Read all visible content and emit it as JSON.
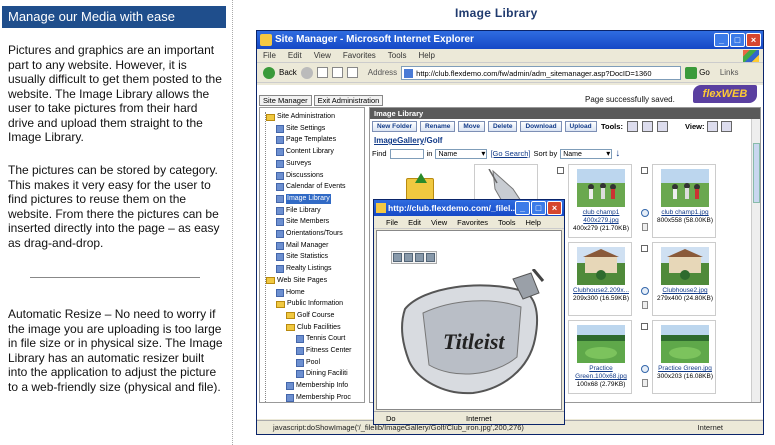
{
  "left": {
    "header": "Manage our Media with ease",
    "para1": "Pictures and graphics are an important part to any website. However, it is usually difficult to get them posted to the website. The Image Library allows the user to take pictures from their hard drive and upload them straight to the Image Library.",
    "para2": "The pictures can be stored by category.  This makes it very easy for the user to find pictures to reuse them on the website.  From there the pictures can be inserted directly into the page – as easy as drag-and-drop.",
    "para3": "Automatic Resize – No need to worry if the image you are uploading is too large in file size or in physical size.  The Image Library has an automatic resizer built into the application to adjust the picture to a web-friendly size (physical and file)."
  },
  "right_title": "Image Library",
  "ie": {
    "title": "Site Manager - Microsoft Internet Explorer",
    "menu": [
      "File",
      "Edit",
      "View",
      "Favorites",
      "Tools",
      "Help"
    ],
    "back_label": "Back",
    "address_label": "Address",
    "address_value": "http://club.flexdemo.com/fw/admin/adm_sitemanager.asp?DocID=1360",
    "go_label": "Go",
    "links_label": "Links",
    "status_text": "javascript:doShowImage('/_filelib/ImageGallery/Golf/Club_iron.jpg',200,276)",
    "zone_text": "Internet"
  },
  "site_manager": {
    "tabs": [
      "Site Manager",
      "Exit Administration"
    ],
    "saved_msg": "Page successfully saved.",
    "logo_a": "flex",
    "logo_b": "WEB"
  },
  "tree": [
    {
      "label": "Site Administration",
      "icon": "folder"
    },
    {
      "label": "Site Settings",
      "icon": "page"
    },
    {
      "label": "Page Templates",
      "icon": "page"
    },
    {
      "label": "Content Library",
      "icon": "page"
    },
    {
      "label": "Surveys",
      "icon": "page"
    },
    {
      "label": "Discussions",
      "icon": "page"
    },
    {
      "label": "Calendar of Events",
      "icon": "page"
    },
    {
      "label": "Image Library",
      "icon": "page"
    },
    {
      "label": "File Library",
      "icon": "page"
    },
    {
      "label": "Site Members",
      "icon": "page"
    },
    {
      "label": "Orientations/Tours",
      "icon": "page"
    },
    {
      "label": "Mail Manager",
      "icon": "page"
    },
    {
      "label": "Site Statistics",
      "icon": "page"
    },
    {
      "label": "Realty Listings",
      "icon": "page"
    },
    {
      "label": "Web Site Pages",
      "icon": "folder"
    },
    {
      "label": "Home",
      "icon": "page"
    },
    {
      "label": "Public Information",
      "icon": "folder"
    },
    {
      "label": "Golf Course",
      "icon": "folder"
    },
    {
      "label": "Club Facilities",
      "icon": "folder"
    },
    {
      "label": "Tennis Court",
      "icon": "page"
    },
    {
      "label": "Fitness Center",
      "icon": "page"
    },
    {
      "label": "Pool",
      "icon": "page"
    },
    {
      "label": "Dining Faciliti",
      "icon": "page"
    },
    {
      "label": "Membership Info",
      "icon": "page"
    },
    {
      "label": "Membership Proc",
      "icon": "page"
    }
  ],
  "library": {
    "title": "Image Library",
    "buttons": [
      "New Folder",
      "Rename",
      "Move",
      "Delete",
      "Download",
      "Upload"
    ],
    "tools_label": "Tools:",
    "view_label": "View:",
    "breadcrumb_link": "ImageGallery",
    "breadcrumb_rest": "/Golf",
    "find_label": "Find",
    "in_label": "in",
    "in_value": "Name",
    "go_search": "[Go Search]",
    "sort_label": "Sort by",
    "sort_value": "Name",
    "tiles": [
      {
        "name": "club champ1 400x279.jpg",
        "size": "400x279 (21.70KB)"
      },
      {
        "name": "club champ1.jpg",
        "size": "800x558 (58.00KB)"
      },
      {
        "name": "Clubhouse2.209x...",
        "size": "209x300 (16.59KB)"
      },
      {
        "name": "Clubhouse2.jpg",
        "size": "279x400 (24.80KB)"
      },
      {
        "name": "Practice Green.100x68.jpg",
        "size": "100x68 (2.79KB)"
      },
      {
        "name": "Practice Green.jpg",
        "size": "300x203 (16.08KB)"
      }
    ]
  },
  "popup": {
    "title": "http://club.flexdemo.com/_filel...",
    "menu": [
      "File",
      "Edit",
      "View",
      "Favorites",
      "Tools",
      "Help"
    ],
    "status_left": "Do",
    "zone_text": "Internet",
    "brand_text": "Titleist"
  }
}
